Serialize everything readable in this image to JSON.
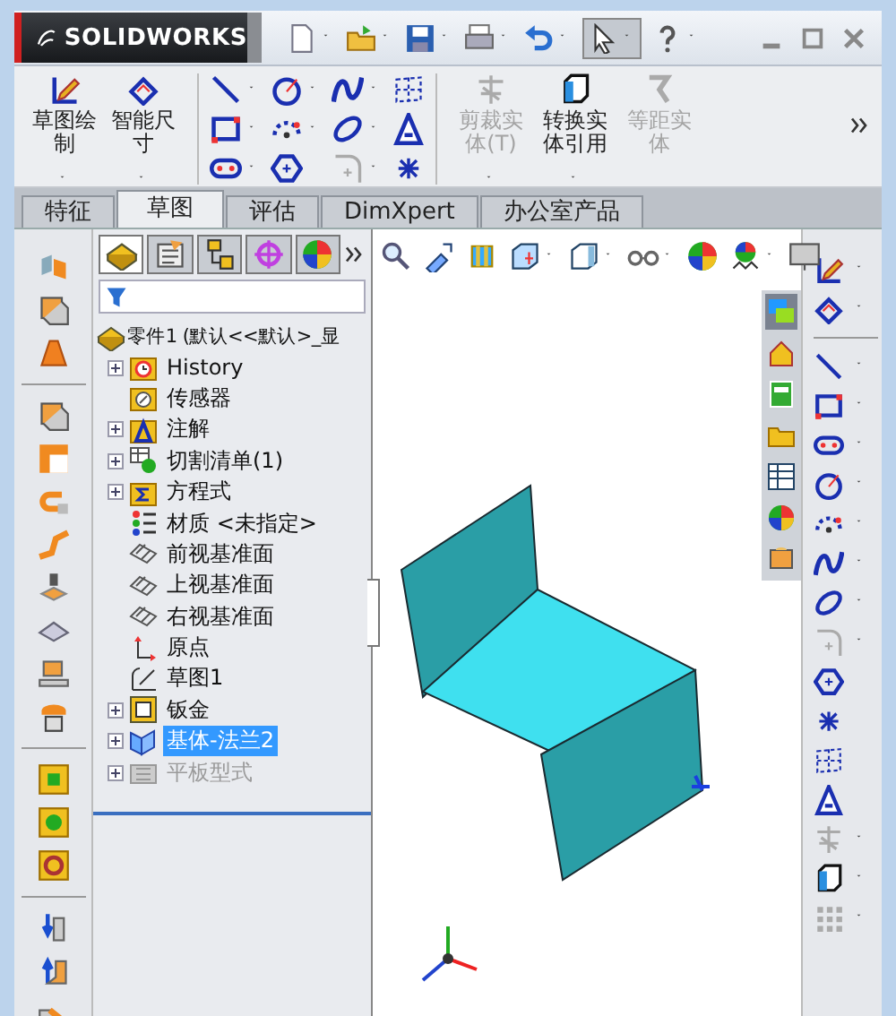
{
  "window": {
    "logo": "SOLIDWORKS"
  },
  "ribbon": {
    "buttons": [
      {
        "label": "草图绘制",
        "kind": "sketch",
        "disabled": false
      },
      {
        "label": "智能尺寸",
        "kind": "dimension",
        "disabled": false
      },
      {
        "label": "剪裁实体(T)",
        "kind": "trim",
        "disabled": true
      },
      {
        "label": "转换实体引用",
        "kind": "convert",
        "disabled": false
      },
      {
        "label": "等距实体",
        "kind": "offset",
        "disabled": true
      }
    ]
  },
  "tabs": [
    {
      "label": "特征",
      "selected": false
    },
    {
      "label": "草图",
      "selected": true
    },
    {
      "label": "评估",
      "selected": false
    },
    {
      "label": "DimXpert",
      "selected": false
    },
    {
      "label": "办公室产品",
      "selected": false
    }
  ],
  "feature_manager": {
    "panel_tabs": [
      {
        "selected": true
      },
      {
        "selected": false
      },
      {
        "selected": false
      },
      {
        "selected": false
      },
      {
        "selected": false
      }
    ],
    "tree": {
      "label": "零件1  (默认<<默认>_显",
      "kind": "part",
      "children": [
        {
          "label": "History",
          "kind": "history",
          "expandable": true,
          "selected": false,
          "disabled": false
        },
        {
          "label": "传感器",
          "kind": "sensor",
          "expandable": false,
          "selected": false,
          "disabled": false
        },
        {
          "label": "注解",
          "kind": "annotation",
          "expandable": true,
          "selected": false,
          "disabled": false
        },
        {
          "label": "切割清单(1)",
          "kind": "cutlist",
          "expandable": true,
          "selected": false,
          "disabled": false
        },
        {
          "label": "方程式",
          "kind": "equation",
          "expandable": true,
          "selected": false,
          "disabled": false
        },
        {
          "label": "材质 <未指定>",
          "kind": "material",
          "expandable": false,
          "selected": false,
          "disabled": false
        },
        {
          "label": "前视基准面",
          "kind": "plane",
          "expandable": false,
          "selected": false,
          "disabled": false
        },
        {
          "label": "上视基准面",
          "kind": "plane",
          "expandable": false,
          "selected": false,
          "disabled": false
        },
        {
          "label": "右视基准面",
          "kind": "plane",
          "expandable": false,
          "selected": false,
          "disabled": false
        },
        {
          "label": "原点",
          "kind": "origin",
          "expandable": false,
          "selected": false,
          "disabled": false
        },
        {
          "label": "草图1",
          "kind": "sketch",
          "expandable": false,
          "selected": false,
          "disabled": false
        },
        {
          "label": "钣金",
          "kind": "sheetmetal",
          "expandable": true,
          "selected": false,
          "disabled": false
        },
        {
          "label": "基体-法兰2",
          "kind": "flange",
          "expandable": true,
          "selected": true,
          "disabled": false
        },
        {
          "label": "平板型式",
          "kind": "flat",
          "expandable": true,
          "selected": false,
          "disabled": true
        }
      ]
    }
  }
}
